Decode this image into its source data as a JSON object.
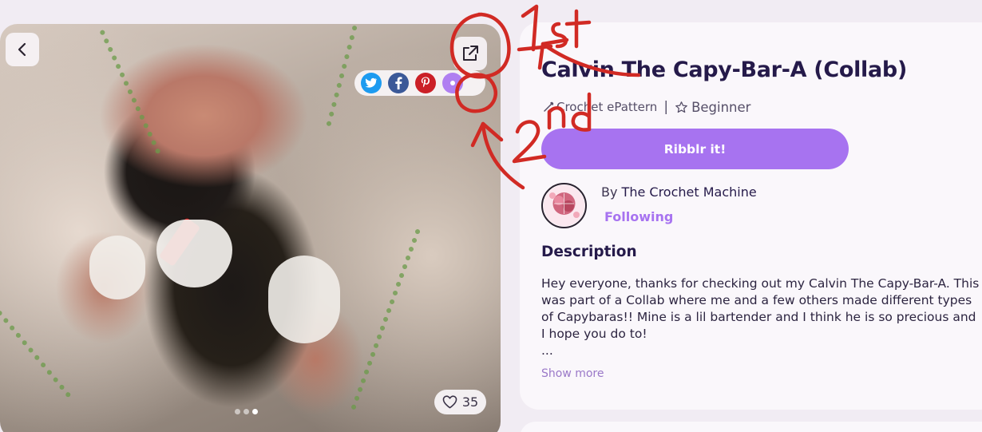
{
  "pattern": {
    "title": "Calvin The Capy-Bar-A (Collab)",
    "category": "Crochet ePattern",
    "level": "Beginner",
    "cta_label": "Ribblr it!",
    "author_prefix": "By",
    "author_name": "The Crochet Machine",
    "follow_status": "Following",
    "description_heading": "Description",
    "description": "Hey everyone, thanks for checking out my Calvin The Capy-Bar-A. This was part of a Collab where me and a few others made different types of Capybaras!! Mine is a lil bartender and I think he is so precious and I hope you do to!",
    "description_ellipsis": "...",
    "show_more_label": "Show more"
  },
  "gallery": {
    "like_count": "35",
    "slide_count": 3,
    "active_slide": 3
  },
  "share": {
    "networks": [
      "twitter",
      "facebook",
      "pinterest",
      "other"
    ]
  },
  "annotations": {
    "first": "1st",
    "second": "2nd"
  },
  "colors": {
    "accent": "#a773f0",
    "title": "#251a4a",
    "twitter": "#1d9bf0",
    "facebook": "#3b5998",
    "pinterest": "#cb2027",
    "annotation": "#d12a24"
  }
}
